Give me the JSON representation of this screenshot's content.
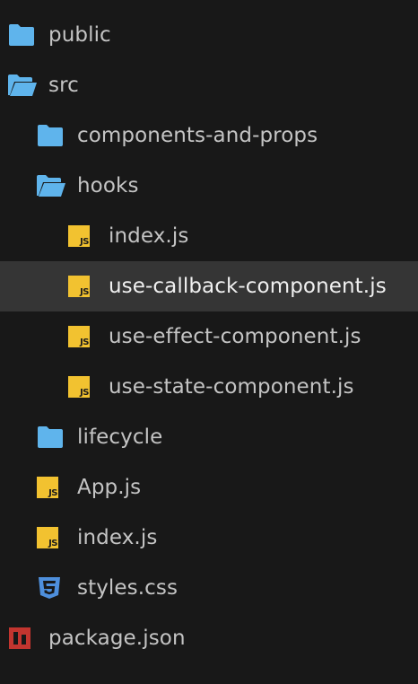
{
  "tree": {
    "items": [
      {
        "label": "public"
      },
      {
        "label": "src"
      },
      {
        "label": "components-and-props"
      },
      {
        "label": "hooks"
      },
      {
        "label": "index.js"
      },
      {
        "label": "use-callback-component.js"
      },
      {
        "label": "use-effect-component.js"
      },
      {
        "label": "use-state-component.js"
      },
      {
        "label": "lifecycle"
      },
      {
        "label": "App.js"
      },
      {
        "label": "index.js"
      },
      {
        "label": "styles.css"
      },
      {
        "label": "package.json"
      }
    ]
  },
  "icons": {
    "js_badge_text": "JS"
  },
  "colors": {
    "background": "#181818",
    "selected_row": "#353535",
    "folder": "#5fb4ec",
    "js": "#f2c230",
    "css": "#4e8fdc",
    "npm": "#c3352f",
    "text": "#c4c4c4"
  }
}
